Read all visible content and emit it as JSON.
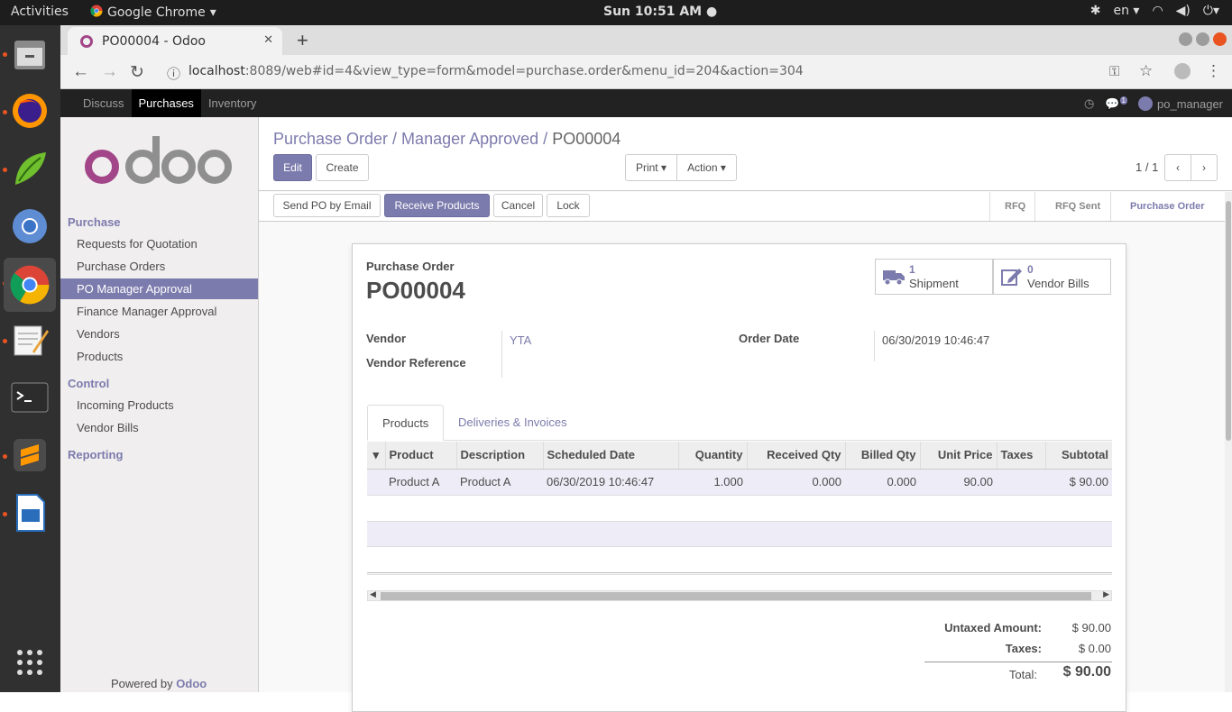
{
  "topbar": {
    "activities": "Activities",
    "app_name": "Google Chrome",
    "clock": "Sun 10:51 AM",
    "lang": "en"
  },
  "browser": {
    "tab_title": "PO00004 - Odoo",
    "url_host": "localhost",
    "url_rest": ":8089/web#id=4&view_type=form&model=purchase.order&menu_id=204&action=304"
  },
  "odoo_nav": {
    "menus": [
      "Discuss",
      "Purchases",
      "Inventory"
    ],
    "active_menu": "Purchases",
    "user": "po_manager",
    "chat_count": "1"
  },
  "sidebar": {
    "sections": [
      {
        "label": "Purchase"
      },
      {
        "label": "Control"
      },
      {
        "label": "Reporting"
      }
    ],
    "purchase_items": [
      "Requests for Quotation",
      "Purchase Orders",
      "PO Manager Approval",
      "Finance Manager Approval",
      "Vendors",
      "Products"
    ],
    "active_item": "PO Manager Approval",
    "control_items": [
      "Incoming Products",
      "Vendor Bills"
    ],
    "powered_prefix": "Powered by",
    "powered_brand": "Odoo"
  },
  "control_panel": {
    "breadcrumb_1": "Purchase Order / Manager Approved /",
    "breadcrumb_2": "PO00004",
    "edit": "Edit",
    "create": "Create",
    "print": "Print",
    "action": "Action",
    "pager": "1 / 1"
  },
  "statusbar": {
    "buttons": [
      "Send PO by Email",
      "Receive Products",
      "Cancel",
      "Lock"
    ],
    "stages": [
      "RFQ",
      "RFQ Sent",
      "Purchase Order"
    ],
    "current_stage": "Purchase Order"
  },
  "form": {
    "doc_type": "Purchase Order",
    "name": "PO00004",
    "shipment_count": "1",
    "shipment_label": "Shipment",
    "bills_count": "0",
    "bills_label": "Vendor Bills",
    "vendor_label": "Vendor",
    "vendor": "YTA",
    "vendor_ref_label": "Vendor Reference",
    "vendor_ref": "",
    "order_date_label": "Order Date",
    "order_date": "06/30/2019 10:46:47",
    "tabs": [
      "Products",
      "Deliveries & Invoices"
    ],
    "columns": [
      "Product",
      "Description",
      "Scheduled Date",
      "Quantity",
      "Received Qty",
      "Billed Qty",
      "Unit Price",
      "Taxes",
      "Subtotal"
    ],
    "rows": [
      [
        "Product A",
        "Product A",
        "06/30/2019 10:46:47",
        "1.000",
        "0.000",
        "0.000",
        "90.00",
        "",
        "$ 90.00"
      ]
    ],
    "untaxed_label": "Untaxed Amount:",
    "untaxed": "$ 90.00",
    "taxes_label": "Taxes:",
    "taxes": "$ 0.00",
    "total_label": "Total:",
    "total": "$ 90.00"
  },
  "colors": {
    "brand": "#7c7bad",
    "topbar": "#1d1d1d",
    "dock": "#303030",
    "accent_orange": "#e95420"
  }
}
